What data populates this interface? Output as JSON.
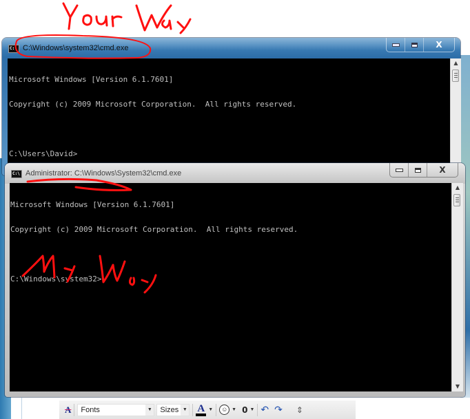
{
  "annotations": {
    "top_label": "Your Way",
    "bottom_label": "My Way",
    "color": "#ff0000"
  },
  "window_user": {
    "title": "C:\\Windows\\system32\\cmd.exe",
    "icon": "cmd-icon",
    "icon_text": "C:\\",
    "controls": {
      "minimize": "minimize-icon",
      "maximize": "maximize-icon",
      "close_label": "X"
    },
    "console_lines": [
      "Microsoft Windows [Version 6.1.7601]",
      "Copyright (c) 2009 Microsoft Corporation.  All rights reserved.",
      "",
      "C:\\Users\\David>"
    ]
  },
  "window_admin": {
    "title": "Administrator: C:\\Windows\\System32\\cmd.exe",
    "icon": "cmd-icon",
    "icon_text": "C:\\",
    "controls": {
      "minimize": "minimize-icon",
      "maximize": "maximize-icon",
      "close_label": "X"
    },
    "console_lines": [
      "Microsoft Windows [Version 6.1.7601]",
      "Copyright (c) 2009 Microsoft Corporation.  All rights reserved.",
      "",
      "C:\\Windows\\system32>"
    ]
  },
  "scrollbar": {
    "up_arrow": "▲",
    "down_arrow": "▼"
  },
  "toolbar": {
    "clear_format_icon": "A",
    "fonts_label": "Fonts",
    "sizes_label": "Sizes",
    "font_color_label": "A",
    "dropdown_arrow": "▼",
    "smiley_glyph": "☺",
    "attach_glyph": "0",
    "undo_glyph": "↶",
    "redo_glyph": "↷",
    "expand_glyph": "⇕"
  }
}
